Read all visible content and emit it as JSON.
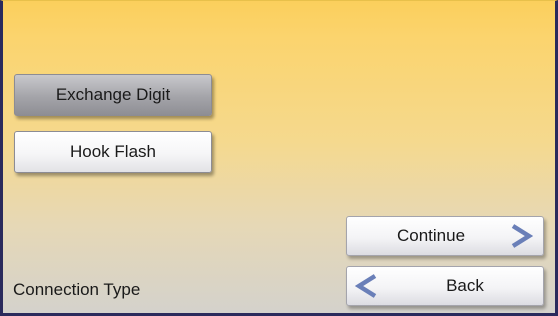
{
  "options": {
    "exchange_digit_label": "Exchange Digit",
    "hook_flash_label": "Hook Flash"
  },
  "nav": {
    "continue_label": "Continue",
    "back_label": "Back"
  },
  "status": {
    "label": "Connection Type"
  },
  "colors": {
    "frame": "#2a2a5c",
    "background_top": "#fbcf5c",
    "background_bottom": "#d4d2cc",
    "selected_button": "#a4a4a9",
    "arrow_blue": "#6a7fb8"
  },
  "icons": {
    "continue": "chevron-right-icon",
    "back": "chevron-left-icon"
  }
}
